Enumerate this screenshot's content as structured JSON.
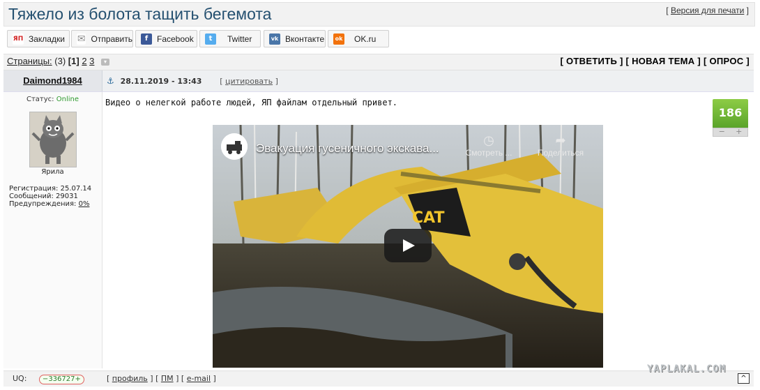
{
  "topic": {
    "title": "Тяжело из болота тащить бегемота",
    "print_label": "Версия для печати"
  },
  "share": [
    {
      "label": "Закладки",
      "icon": "yp-bookmark-icon",
      "icon_text": "ЯП",
      "color": "#d11f1f"
    },
    {
      "label": "Отправить",
      "icon": "mail-icon",
      "icon_text": "✉",
      "color": "#8a8a8a"
    },
    {
      "label": "Facebook",
      "icon": "facebook-icon",
      "icon_text": "f",
      "color": "#3b5998"
    },
    {
      "label": "Twitter",
      "icon": "twitter-icon",
      "icon_text": "t",
      "color": "#55acee"
    },
    {
      "label": "Вконтакте",
      "icon": "vk-icon",
      "icon_text": "vk",
      "color": "#4a76a8"
    },
    {
      "label": "OK.ru",
      "icon": "ok-icon",
      "icon_text": "ok",
      "color": "#f2720c"
    }
  ],
  "pages": {
    "label": "Страницы:",
    "count": "(3)",
    "current": "[1]",
    "p2": "2",
    "p3": "3"
  },
  "actions": {
    "text": "[ ОТВЕТИТЬ ] [ НОВАЯ ТЕМА ] [ ОПРОС ]"
  },
  "post": {
    "author": "Daimond1984",
    "date": "28.11.2019 - 13:43",
    "quote_label": "цитировать",
    "text": "Видео о нелегкой работе людей, ЯП файлам отдельный привет.",
    "rating": "186",
    "rating_minus": "−",
    "rating_plus": "+"
  },
  "user": {
    "status_label": "Статус:",
    "status_value": "Online",
    "avatar_label": "Ярила",
    "reg": "Регистрация: 25.07.14",
    "msgs": "Сообщений: 29031",
    "warn_label": "Предупреждения:",
    "warn_value": "0%"
  },
  "video": {
    "title": "Эвакуация гусеничного экскава...",
    "watch_later": "Смотреть ...",
    "share": "Поделиться"
  },
  "footer": {
    "uq_label": "UQ:",
    "uq_value": "336727",
    "profile": "профиль",
    "pm": "ПМ",
    "email": "e-mail",
    "up": "^"
  },
  "watermark": "YAPLAKAL.COM"
}
